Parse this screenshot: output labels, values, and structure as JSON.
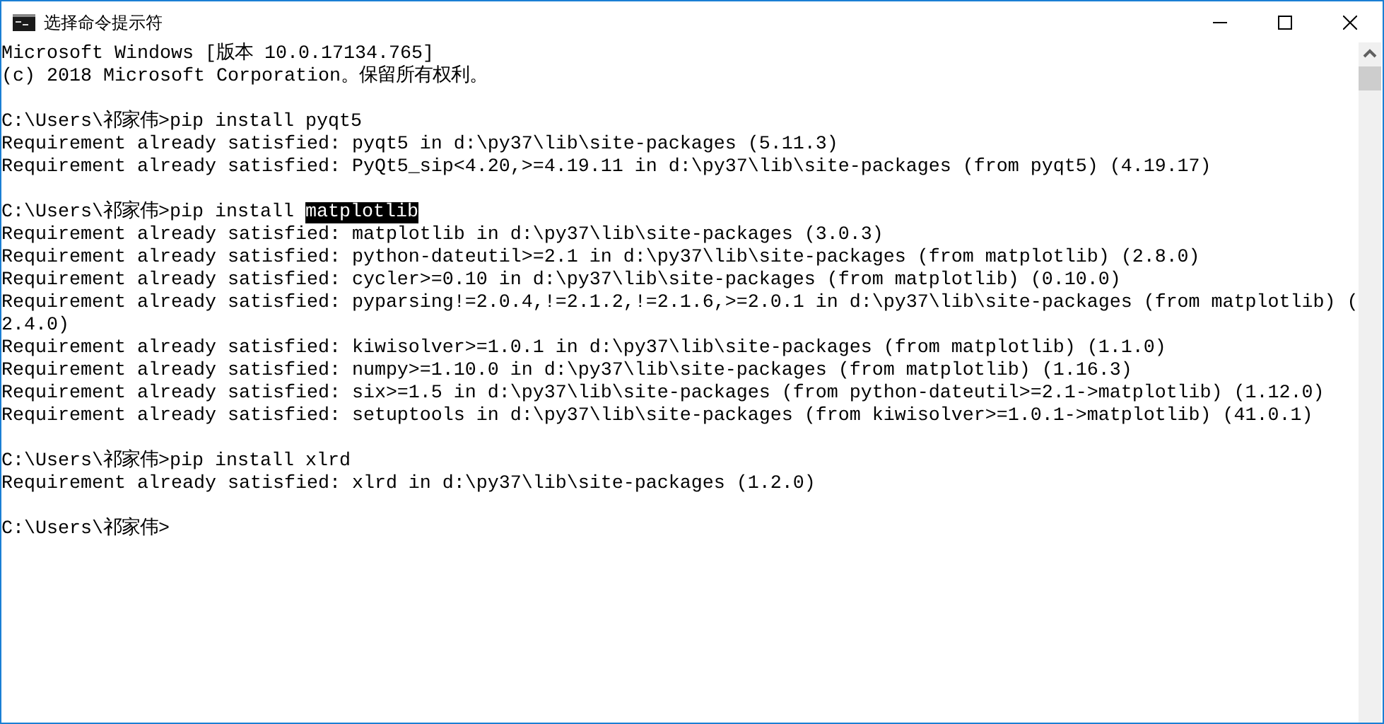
{
  "window": {
    "title": "选择命令提示符"
  },
  "console": {
    "blocks": [
      [
        {
          "text": "Microsoft Windows [版本 10.0.17134.765]"
        },
        {
          "text": "(c) 2018 Microsoft Corporation。保留所有权利。"
        }
      ],
      [
        {
          "text": "C:\\Users\\祁家伟>pip install pyqt5"
        },
        {
          "text": "Requirement already satisfied: pyqt5 in d:\\py37\\lib\\site-packages (5.11.3)"
        },
        {
          "text": "Requirement already satisfied: PyQt5_sip<4.20,>=4.19.11 in d:\\py37\\lib\\site-packages (from pyqt5) (4.19.17)"
        }
      ],
      [
        {
          "segments": [
            {
              "text": "C:\\Users\\祁家伟>pip install ",
              "selected": false
            },
            {
              "text": "matplotlib",
              "selected": true
            }
          ]
        },
        {
          "text": "Requirement already satisfied: matplotlib in d:\\py37\\lib\\site-packages (3.0.3)"
        },
        {
          "text": "Requirement already satisfied: python-dateutil>=2.1 in d:\\py37\\lib\\site-packages (from matplotlib) (2.8.0)"
        },
        {
          "text": "Requirement already satisfied: cycler>=0.10 in d:\\py37\\lib\\site-packages (from matplotlib) (0.10.0)"
        },
        {
          "text": "Requirement already satisfied: pyparsing!=2.0.4,!=2.1.2,!=2.1.6,>=2.0.1 in d:\\py37\\lib\\site-packages (from matplotlib) ("
        },
        {
          "text": "2.4.0)"
        },
        {
          "text": "Requirement already satisfied: kiwisolver>=1.0.1 in d:\\py37\\lib\\site-packages (from matplotlib) (1.1.0)"
        },
        {
          "text": "Requirement already satisfied: numpy>=1.10.0 in d:\\py37\\lib\\site-packages (from matplotlib) (1.16.3)"
        },
        {
          "text": "Requirement already satisfied: six>=1.5 in d:\\py37\\lib\\site-packages (from python-dateutil>=2.1->matplotlib) (1.12.0)"
        },
        {
          "text": "Requirement already satisfied: setuptools in d:\\py37\\lib\\site-packages (from kiwisolver>=1.0.1->matplotlib) (41.0.1)"
        }
      ],
      [
        {
          "text": "C:\\Users\\祁家伟>pip install xlrd"
        },
        {
          "text": "Requirement already satisfied: xlrd in d:\\py37\\lib\\site-packages (1.2.0)"
        }
      ],
      [
        {
          "text": "C:\\Users\\祁家伟>"
        }
      ]
    ]
  }
}
